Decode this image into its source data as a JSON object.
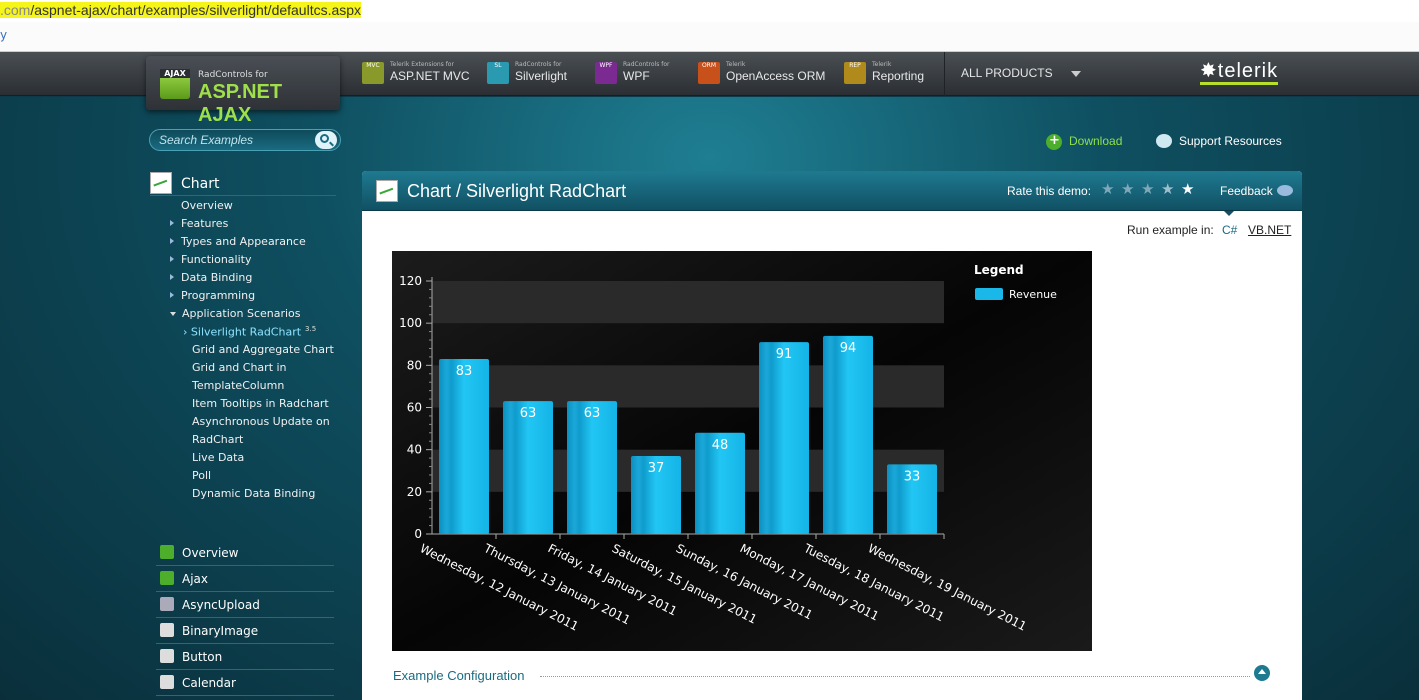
{
  "browser": {
    "url_prefix": ".com",
    "url_path": "/aspnet-ajax/chart/examples/silverlight/defaultcs.aspx",
    "bookmark_fragment": "y"
  },
  "header": {
    "logo_small": "RadControls for",
    "logo_big": "ASP.NET AJAX",
    "logo_badge": "AJAX",
    "products": [
      {
        "badge": "MVC",
        "small": "Telerik Extensions for",
        "main": "ASP.NET MVC",
        "color": "#8a9a2a"
      },
      {
        "badge": "SL",
        "small": "RadControls for",
        "main": "Silverlight",
        "color": "#2a9ab0"
      },
      {
        "badge": "WPF",
        "small": "RadControls for",
        "main": "WPF",
        "color": "#7a2a90"
      },
      {
        "badge": "ORM",
        "small": "Telerik",
        "main": "OpenAccess ORM",
        "color": "#c8501a"
      },
      {
        "badge": "REP",
        "small": "Telerik",
        "main": "Reporting",
        "color": "#b08a1a"
      }
    ],
    "all_products": "ALL PRODUCTS",
    "brand": "telerik"
  },
  "search": {
    "placeholder": "Search Examples"
  },
  "toplinks": {
    "download": "Download",
    "support": "Support Resources"
  },
  "sidebar": {
    "title": "Chart",
    "items": [
      {
        "label": "Overview"
      },
      {
        "label": "Features"
      },
      {
        "label": "Types and Appearance"
      },
      {
        "label": "Functionality"
      },
      {
        "label": "Data Binding"
      },
      {
        "label": "Programming"
      },
      {
        "label": "Application Scenarios"
      }
    ],
    "subitems": [
      {
        "label": "Silverlight RadChart",
        "tag": "3.5"
      },
      {
        "label": "Grid and Aggregate Chart"
      },
      {
        "label": "Grid and Chart in"
      },
      {
        "label": "TemplateColumn"
      },
      {
        "label": "Item Tooltips in Radchart"
      },
      {
        "label": "Asynchronous Update on"
      },
      {
        "label": "RadChart"
      },
      {
        "label": "Live Data"
      },
      {
        "label": "Poll"
      },
      {
        "label": "Dynamic Data Binding"
      }
    ],
    "controls": [
      {
        "label": "Overview",
        "color": "#4cae2a",
        "icon": "grid-icon"
      },
      {
        "label": "Ajax",
        "color": "#4cae2a",
        "icon": "refresh-icon"
      },
      {
        "label": "AsyncUpload",
        "color": "#aab",
        "icon": "upload-icon"
      },
      {
        "label": "BinaryImage",
        "color": "#ddd",
        "icon": "image-icon"
      },
      {
        "label": "Button",
        "color": "#ddd",
        "icon": "button-icon"
      },
      {
        "label": "Calendar",
        "color": "#ddd",
        "icon": "calendar-icon"
      }
    ]
  },
  "panel": {
    "title": "Chart / Silverlight RadChart",
    "rate_label": "Rate this demo:",
    "feedback": "Feedback",
    "run_label": "Run example in:",
    "lang_cs": "C#",
    "lang_vb": "VB.NET",
    "example_config": "Example Configuration"
  },
  "chart_data": {
    "type": "bar",
    "legend_title": "Legend",
    "categories": [
      "Wednesday, 12 January 2011",
      "Thursday, 13 January 2011",
      "Friday, 14 January 2011",
      "Saturday, 15 January 2011",
      "Sunday, 16 January 2011",
      "Monday, 17 January 2011",
      "Tuesday, 18 January 2011",
      "Wednesday, 19 January 2011"
    ],
    "series": [
      {
        "name": "Revenue",
        "values": [
          83,
          63,
          63,
          37,
          48,
          91,
          94,
          33
        ]
      }
    ],
    "ylim": [
      0,
      120
    ],
    "yticks": [
      0,
      20,
      40,
      60,
      80,
      100,
      120
    ],
    "bar_color": "#19b8e8",
    "grid": "alternating bands",
    "legend_position": "top-right"
  }
}
